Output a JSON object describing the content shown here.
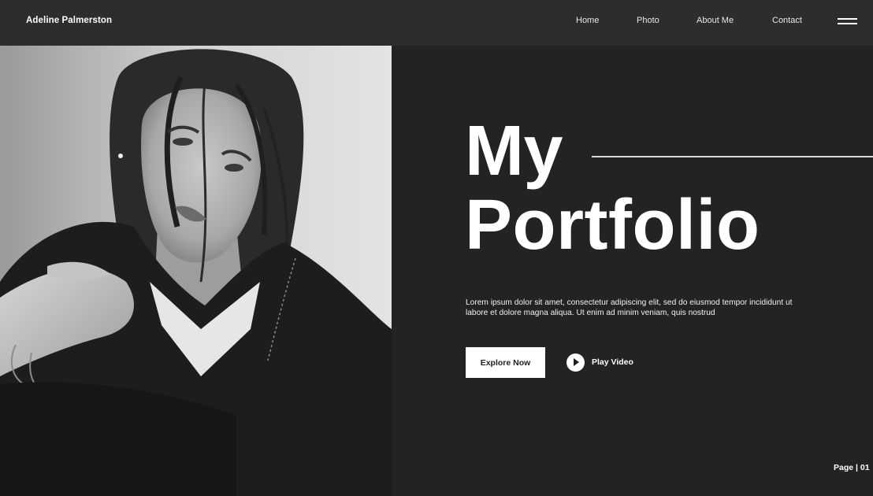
{
  "header": {
    "brand": "Adeline Palmerston",
    "nav": [
      "Home",
      "Photo",
      "About Me",
      "Contact"
    ]
  },
  "hero": {
    "title_line1": "My",
    "title_line2": "Portfolio",
    "description": "Lorem ipsum dolor sit amet, consectetur adipiscing elit, sed do eiusmod tempor incididunt ut labore et dolore magna aliqua. Ut enim ad minim veniam, quis nostrud",
    "explore_label": "Explore Now",
    "play_label": "Play Video"
  },
  "footer": {
    "page_indicator": "Page | 01"
  },
  "icons": {
    "menu": "hamburger-menu-icon",
    "play": "play-icon"
  },
  "colors": {
    "background": "#232323",
    "header": "#2d2d2d",
    "accent": "#ffffff"
  }
}
